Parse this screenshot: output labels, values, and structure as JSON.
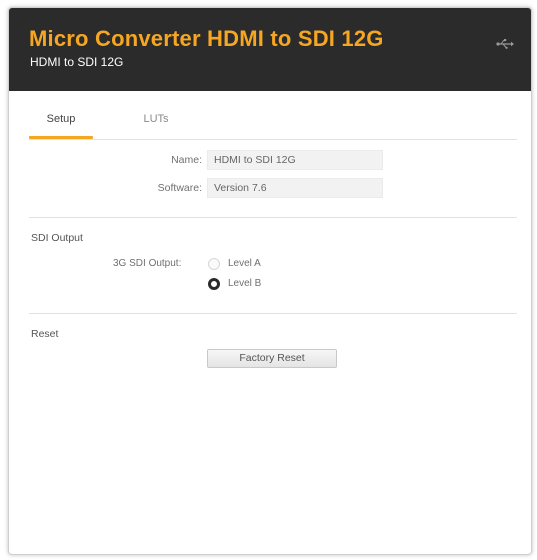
{
  "header": {
    "title": "Micro Converter HDMI to SDI 12G",
    "subtitle": "HDMI to SDI 12G",
    "accent_color": "#f5a623",
    "background_color": "#2b2b2b",
    "connection_icon": "usb-icon"
  },
  "tabs": [
    {
      "label": "Setup",
      "active": true
    },
    {
      "label": "LUTs",
      "active": false
    }
  ],
  "device_info": {
    "name_label": "Name:",
    "name_value": "HDMI to SDI 12G",
    "software_label": "Software:",
    "software_value": "Version 7.6"
  },
  "sdi_output": {
    "section_title": "SDI Output",
    "option_label": "3G SDI Output:",
    "options": [
      {
        "label": "Level A",
        "selected": false
      },
      {
        "label": "Level B",
        "selected": true
      }
    ]
  },
  "reset": {
    "section_title": "Reset",
    "button_label": "Factory Reset"
  }
}
